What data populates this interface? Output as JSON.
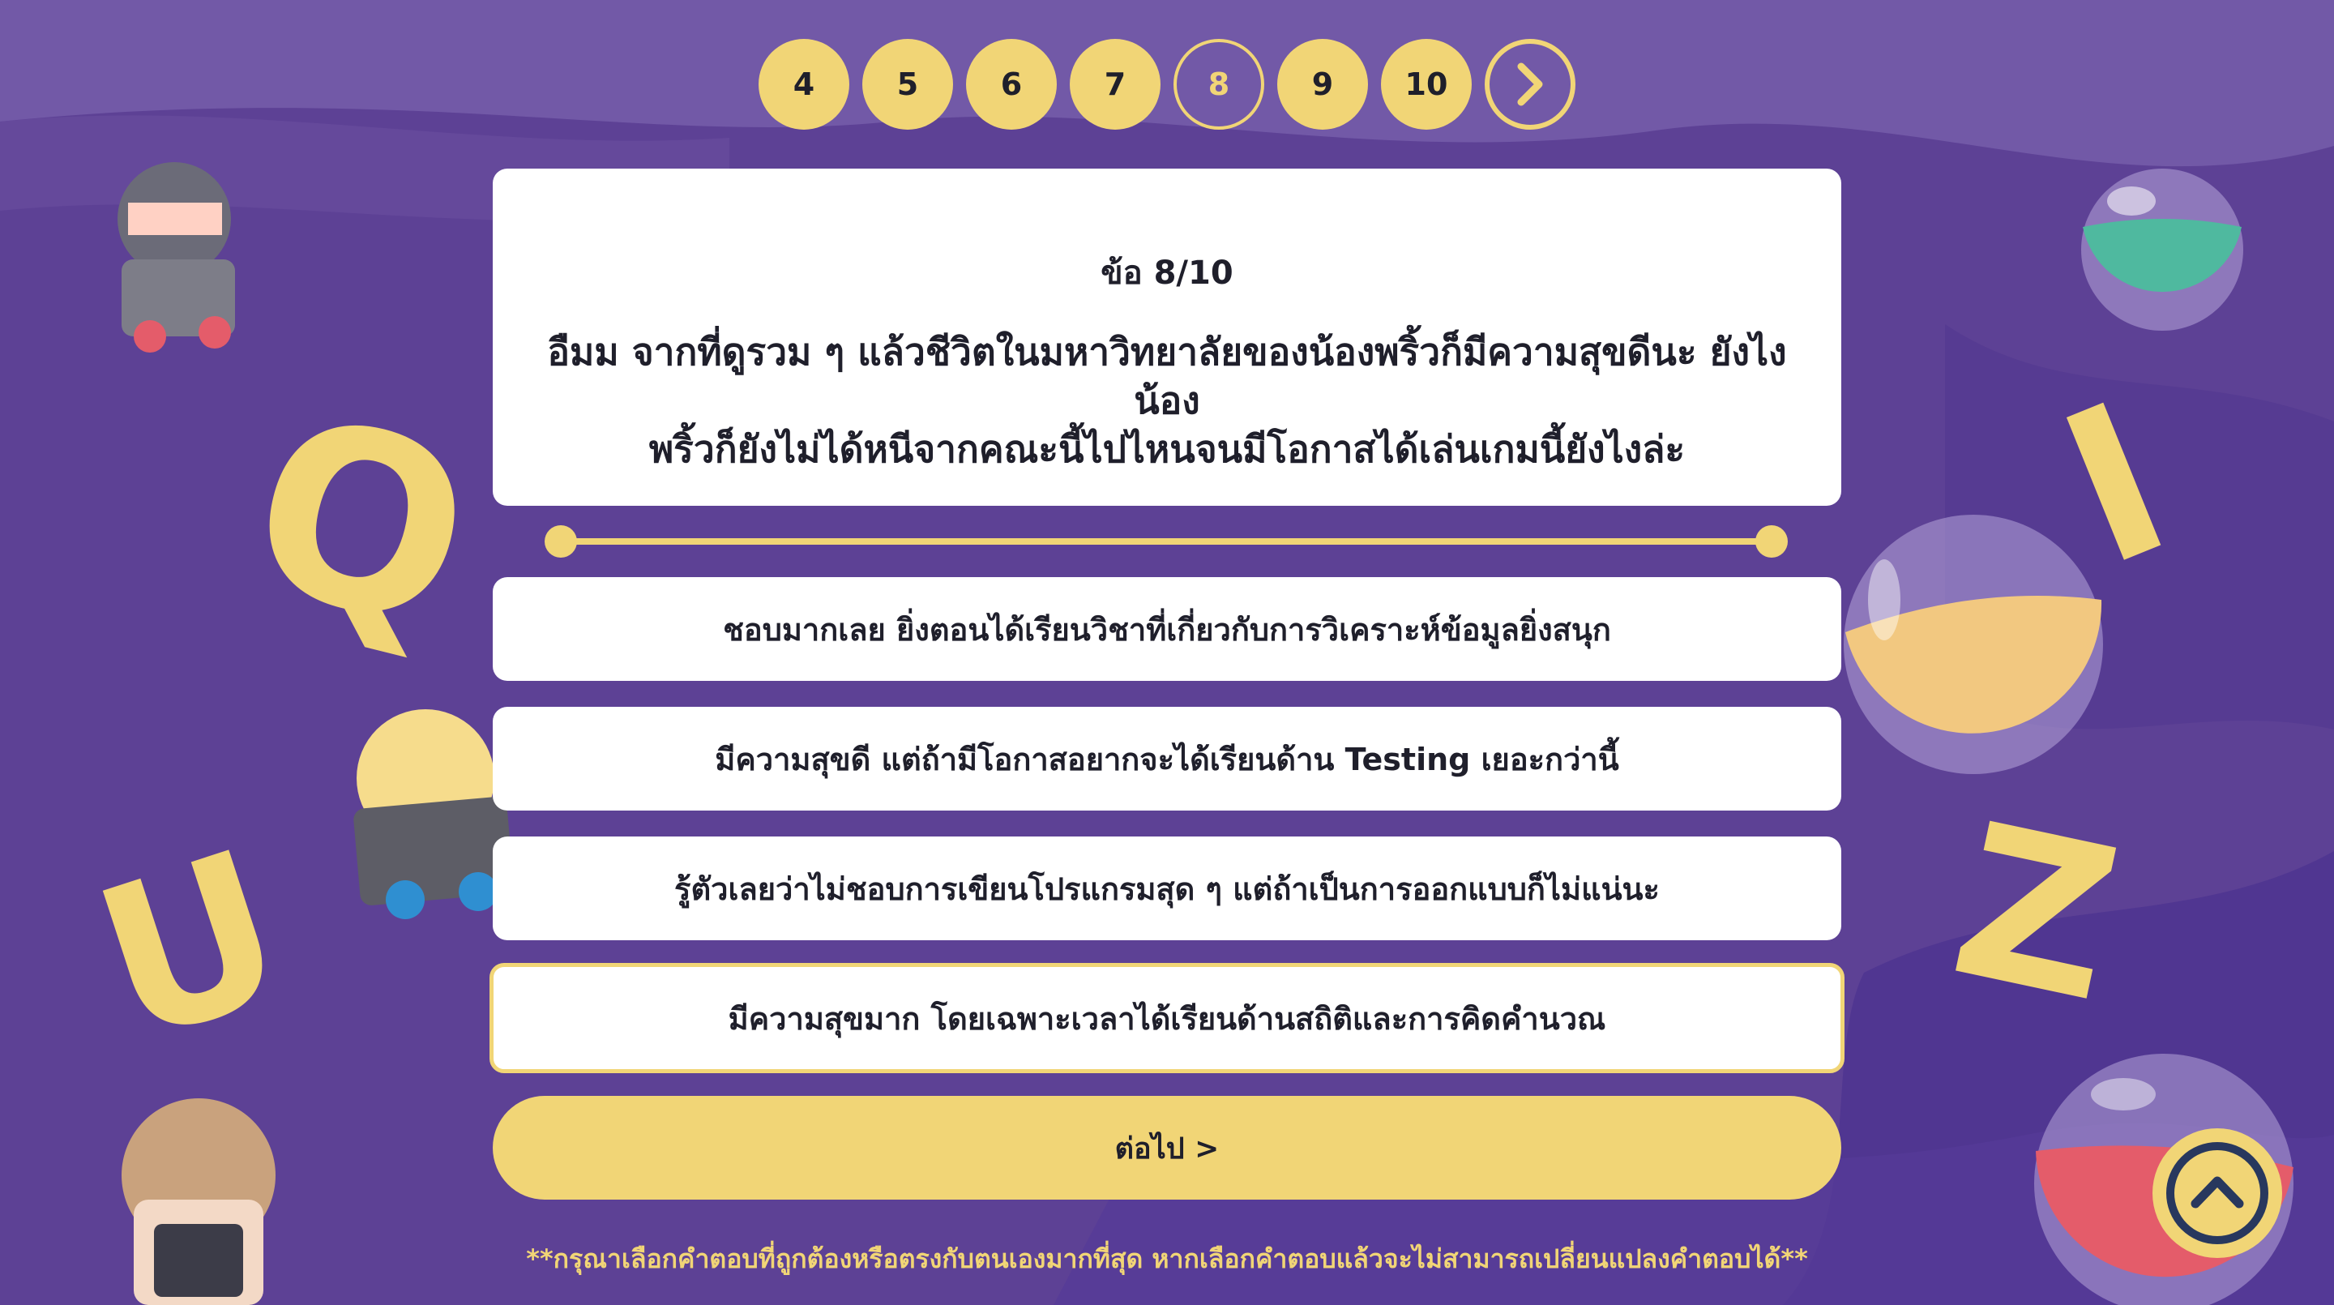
{
  "pagination": {
    "pages": [
      "4",
      "5",
      "6",
      "7",
      "8",
      "9",
      "10"
    ],
    "current": "8",
    "next_icon": "chevron-right-icon"
  },
  "question": {
    "number": "ข้อ 8/10",
    "line1": "อืมม จากที่ดูรวม ๆ แล้วชีวิตในมหาวิทยาลัยของน้องพริ้วก็มีความสุขดีนะ ยังไงน้อง",
    "line2": "พริ้วก็ยังไม่ได้หนีจากคณะนี้ไปไหนจนมีโอกาสได้เล่นเกมนี้ยังไงล่ะ"
  },
  "answers": [
    "ชอบมากเลย ยิ่งตอนได้เรียนวิชาที่เกี่ยวกับการวิเคราะห์ข้อมูลยิ่งสนุก",
    "มีความสุขดี แต่ถ้ามีโอกาสอยากจะได้เรียนด้าน Testing เยอะกว่านี้",
    "รู้ตัวเลยว่าไม่ชอบการเขียนโปรแกรมสุด ๆ แต่ถ้าเป็นการออกแบบก็ไม่แน่นะ",
    "มีความสุขมาก โดยเฉพาะเวลาได้เรียนด้านสถิติและการคิดคำนวณ"
  ],
  "selected_answer_index": 3,
  "next_button": "ต่อไป >",
  "note": "**กรุณาเลือกคำตอบที่ถูกต้องหรือตรงกับตนเองมากที่สุด หากเลือกคำตอบแล้วจะไม่สามารถเปลี่ยนแปลงคำตอบได้**",
  "decor": {
    "letters": [
      "Q",
      "U",
      "I",
      "Z"
    ],
    "scroll_top_icon": "chevron-up-icon"
  },
  "colors": {
    "background": "#5b3f94",
    "accent": "#f1d576",
    "card": "#ffffff",
    "text": "#1f1f2b"
  }
}
